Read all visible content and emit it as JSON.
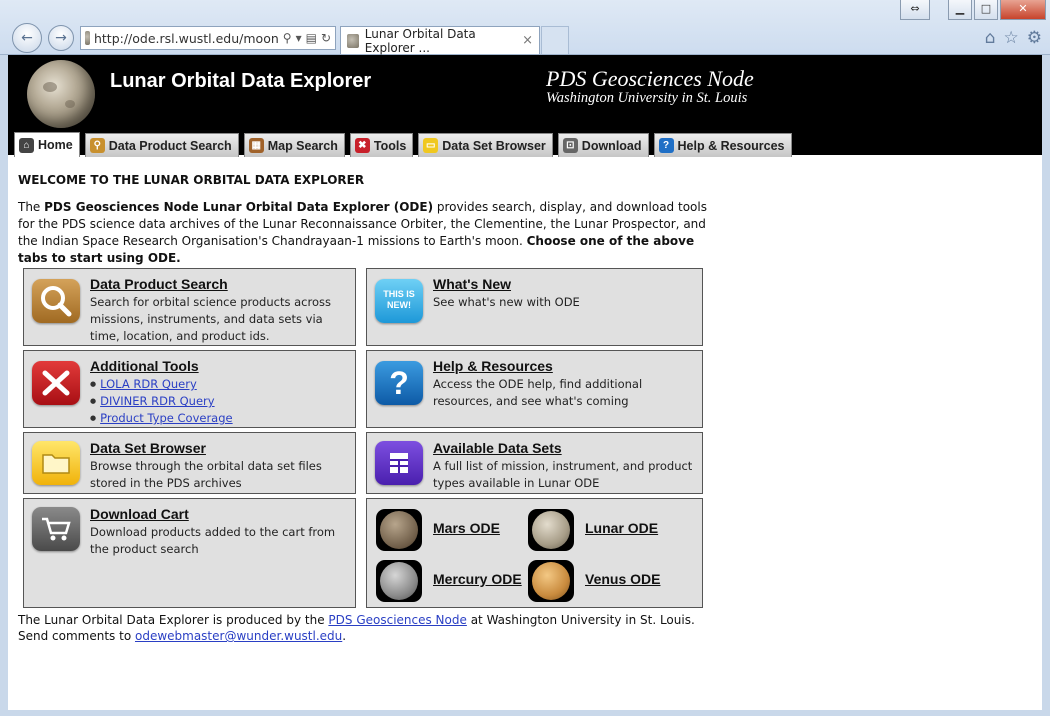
{
  "browser": {
    "url": "http://ode.rsl.wustl.edu/moon",
    "tab_title": "Lunar Orbital Data Explorer ...",
    "tab_close": "×"
  },
  "banner": {
    "title": "Lunar Orbital Data Explorer",
    "node_title": "PDS Geosciences Node",
    "node_subtitle": "Washington University in St. Louis"
  },
  "tabs": [
    {
      "label": "Home",
      "icon": "home-icon",
      "active": true
    },
    {
      "label": "Data Product Search",
      "icon": "search-icon"
    },
    {
      "label": "Map Search",
      "icon": "map-icon"
    },
    {
      "label": "Tools",
      "icon": "tools-icon"
    },
    {
      "label": "Data Set Browser",
      "icon": "folder-icon"
    },
    {
      "label": "Download",
      "icon": "cart-icon"
    },
    {
      "label": "Help & Resources",
      "icon": "help-icon"
    }
  ],
  "welcome": {
    "heading": "WELCOME TO THE LUNAR ORBITAL DATA EXPLORER",
    "intro_bold": "PDS Geosciences Node Lunar Orbital Data Explorer (ODE)",
    "intro_pre": "The ",
    "intro_text": " provides search, display, and download tools for the PDS science data archives of the Lunar Reconnaissance Orbiter, the Clementine, the Lunar Prospector, and the Indian Space Research Organisation's Chandrayaan-1 missions to Earth's moon. ",
    "intro_cta": "Choose one of the above tabs to start using ODE."
  },
  "boxes": {
    "data_product_search": {
      "title": "Data Product Search",
      "desc": "Search for orbital science products across missions, instruments, and data sets via time, location, and product ids."
    },
    "whats_new": {
      "title": "What's New",
      "desc": "See what's new with ODE",
      "icon_text": "THIS IS NEW!"
    },
    "additional_tools": {
      "title": "Additional Tools",
      "links": [
        "LOLA RDR Query",
        "DIVINER RDR Query",
        "Product Type Coverage"
      ]
    },
    "help_resources": {
      "title": "Help & Resources",
      "desc": "Access the ODE help, find additional resources, and see what's coming"
    },
    "data_set_browser": {
      "title": "Data Set Browser",
      "desc": "Browse through the orbital data set files stored in the PDS archives"
    },
    "available_data_sets": {
      "title": "Available Data Sets",
      "desc": "A full list of mission, instrument, and product types available in Lunar ODE"
    },
    "download_cart": {
      "title": "Download Cart",
      "desc": "Download products added to the cart from the product search"
    },
    "ode_sites": [
      "Mars ODE",
      "Lunar ODE",
      "Mercury ODE",
      "Venus ODE"
    ]
  },
  "footer": {
    "line1_pre": "The Lunar Orbital Data Explorer is produced by the ",
    "line1_link": "PDS Geosciences Node",
    "line1_post": " at Washington University in St. Louis.",
    "line2_pre": "Send comments to ",
    "line2_link": "odewebmaster@wunder.wustl.edu",
    "line2_post": "."
  }
}
